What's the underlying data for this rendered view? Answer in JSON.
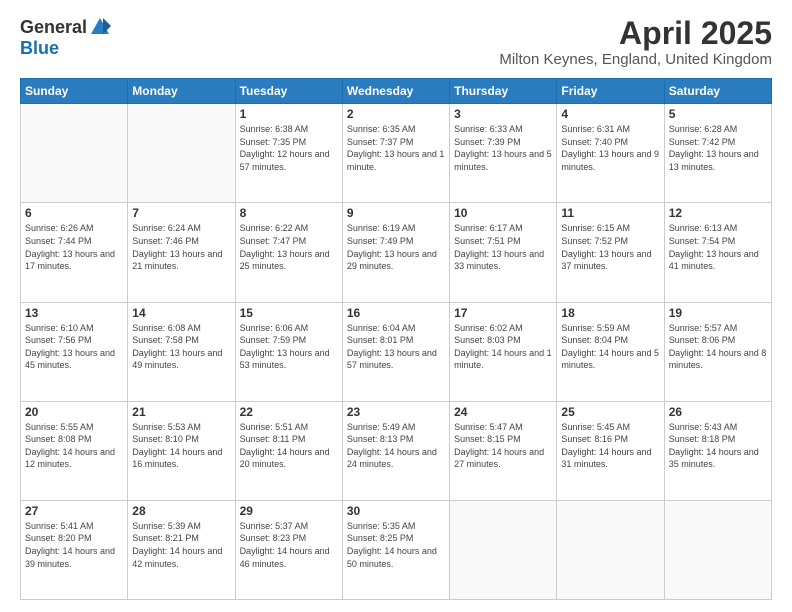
{
  "logo": {
    "general": "General",
    "blue": "Blue"
  },
  "header": {
    "title": "April 2025",
    "subtitle": "Milton Keynes, England, United Kingdom"
  },
  "days_of_week": [
    "Sunday",
    "Monday",
    "Tuesday",
    "Wednesday",
    "Thursday",
    "Friday",
    "Saturday"
  ],
  "weeks": [
    [
      {
        "day": "",
        "info": ""
      },
      {
        "day": "",
        "info": ""
      },
      {
        "day": "1",
        "info": "Sunrise: 6:38 AM\nSunset: 7:35 PM\nDaylight: 12 hours and 57 minutes."
      },
      {
        "day": "2",
        "info": "Sunrise: 6:35 AM\nSunset: 7:37 PM\nDaylight: 13 hours and 1 minute."
      },
      {
        "day": "3",
        "info": "Sunrise: 6:33 AM\nSunset: 7:39 PM\nDaylight: 13 hours and 5 minutes."
      },
      {
        "day": "4",
        "info": "Sunrise: 6:31 AM\nSunset: 7:40 PM\nDaylight: 13 hours and 9 minutes."
      },
      {
        "day": "5",
        "info": "Sunrise: 6:28 AM\nSunset: 7:42 PM\nDaylight: 13 hours and 13 minutes."
      }
    ],
    [
      {
        "day": "6",
        "info": "Sunrise: 6:26 AM\nSunset: 7:44 PM\nDaylight: 13 hours and 17 minutes."
      },
      {
        "day": "7",
        "info": "Sunrise: 6:24 AM\nSunset: 7:46 PM\nDaylight: 13 hours and 21 minutes."
      },
      {
        "day": "8",
        "info": "Sunrise: 6:22 AM\nSunset: 7:47 PM\nDaylight: 13 hours and 25 minutes."
      },
      {
        "day": "9",
        "info": "Sunrise: 6:19 AM\nSunset: 7:49 PM\nDaylight: 13 hours and 29 minutes."
      },
      {
        "day": "10",
        "info": "Sunrise: 6:17 AM\nSunset: 7:51 PM\nDaylight: 13 hours and 33 minutes."
      },
      {
        "day": "11",
        "info": "Sunrise: 6:15 AM\nSunset: 7:52 PM\nDaylight: 13 hours and 37 minutes."
      },
      {
        "day": "12",
        "info": "Sunrise: 6:13 AM\nSunset: 7:54 PM\nDaylight: 13 hours and 41 minutes."
      }
    ],
    [
      {
        "day": "13",
        "info": "Sunrise: 6:10 AM\nSunset: 7:56 PM\nDaylight: 13 hours and 45 minutes."
      },
      {
        "day": "14",
        "info": "Sunrise: 6:08 AM\nSunset: 7:58 PM\nDaylight: 13 hours and 49 minutes."
      },
      {
        "day": "15",
        "info": "Sunrise: 6:06 AM\nSunset: 7:59 PM\nDaylight: 13 hours and 53 minutes."
      },
      {
        "day": "16",
        "info": "Sunrise: 6:04 AM\nSunset: 8:01 PM\nDaylight: 13 hours and 57 minutes."
      },
      {
        "day": "17",
        "info": "Sunrise: 6:02 AM\nSunset: 8:03 PM\nDaylight: 14 hours and 1 minute."
      },
      {
        "day": "18",
        "info": "Sunrise: 5:59 AM\nSunset: 8:04 PM\nDaylight: 14 hours and 5 minutes."
      },
      {
        "day": "19",
        "info": "Sunrise: 5:57 AM\nSunset: 8:06 PM\nDaylight: 14 hours and 8 minutes."
      }
    ],
    [
      {
        "day": "20",
        "info": "Sunrise: 5:55 AM\nSunset: 8:08 PM\nDaylight: 14 hours and 12 minutes."
      },
      {
        "day": "21",
        "info": "Sunrise: 5:53 AM\nSunset: 8:10 PM\nDaylight: 14 hours and 16 minutes."
      },
      {
        "day": "22",
        "info": "Sunrise: 5:51 AM\nSunset: 8:11 PM\nDaylight: 14 hours and 20 minutes."
      },
      {
        "day": "23",
        "info": "Sunrise: 5:49 AM\nSunset: 8:13 PM\nDaylight: 14 hours and 24 minutes."
      },
      {
        "day": "24",
        "info": "Sunrise: 5:47 AM\nSunset: 8:15 PM\nDaylight: 14 hours and 27 minutes."
      },
      {
        "day": "25",
        "info": "Sunrise: 5:45 AM\nSunset: 8:16 PM\nDaylight: 14 hours and 31 minutes."
      },
      {
        "day": "26",
        "info": "Sunrise: 5:43 AM\nSunset: 8:18 PM\nDaylight: 14 hours and 35 minutes."
      }
    ],
    [
      {
        "day": "27",
        "info": "Sunrise: 5:41 AM\nSunset: 8:20 PM\nDaylight: 14 hours and 39 minutes."
      },
      {
        "day": "28",
        "info": "Sunrise: 5:39 AM\nSunset: 8:21 PM\nDaylight: 14 hours and 42 minutes."
      },
      {
        "day": "29",
        "info": "Sunrise: 5:37 AM\nSunset: 8:23 PM\nDaylight: 14 hours and 46 minutes."
      },
      {
        "day": "30",
        "info": "Sunrise: 5:35 AM\nSunset: 8:25 PM\nDaylight: 14 hours and 50 minutes."
      },
      {
        "day": "",
        "info": ""
      },
      {
        "day": "",
        "info": ""
      },
      {
        "day": "",
        "info": ""
      }
    ]
  ]
}
